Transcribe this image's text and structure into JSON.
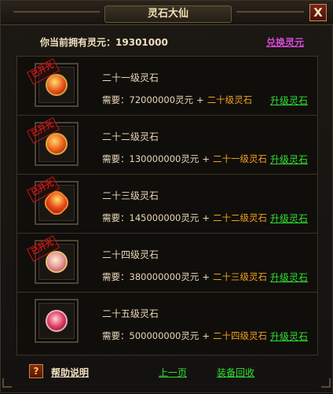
{
  "window": {
    "title": "灵石大仙",
    "close_label": "X"
  },
  "summary": {
    "owned_label": "你当前拥有灵元：",
    "owned_value": "19301000",
    "exchange_label": "兑换灵元"
  },
  "items": [
    {
      "name": "二十一级灵石",
      "stamp": "已开光",
      "req_label": "需要：",
      "req_amount": "72000000灵元",
      "plus": "+",
      "req_gem": "二十级灵石",
      "upgrade_label": "升级灵石",
      "gem_icon": "fire-gem-icon"
    },
    {
      "name": "二十二级灵石",
      "stamp": "已开光",
      "req_label": "需要：",
      "req_amount": "130000000灵元",
      "plus": "+",
      "req_gem": "二十一级灵石",
      "upgrade_label": "升级灵石",
      "gem_icon": "flame-orb-icon"
    },
    {
      "name": "二十三级灵石",
      "stamp": "已开光",
      "req_label": "需要：",
      "req_amount": "145000000灵元",
      "plus": "+",
      "req_gem": "二十二级灵石",
      "upgrade_label": "升级灵石",
      "gem_icon": "heart-gem-icon"
    },
    {
      "name": "二十四级灵石",
      "stamp": "已开光",
      "req_label": "需要：",
      "req_amount": "380000000灵元",
      "plus": "+",
      "req_gem": "二十三级灵石",
      "upgrade_label": "升级灵石",
      "gem_icon": "pearl-gem-icon"
    },
    {
      "name": "二十五级灵石",
      "stamp": "",
      "req_label": "需要：",
      "req_amount": "500000000灵元",
      "plus": "+",
      "req_gem": "二十四级灵石",
      "upgrade_label": "升级灵石",
      "gem_icon": "ruby-flower-icon"
    }
  ],
  "footer": {
    "help_icon": "?",
    "help_label": "帮助说明",
    "prev_label": "上一页",
    "recycle_label": "装备回收"
  }
}
